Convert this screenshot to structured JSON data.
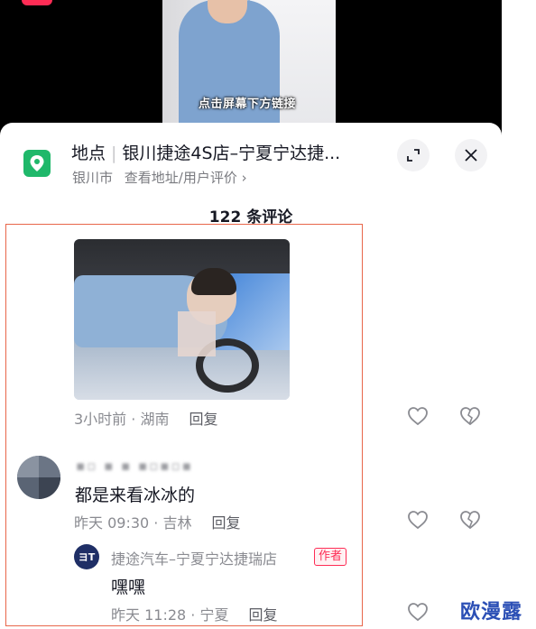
{
  "video": {
    "subtitle": "点击屏幕下方链接"
  },
  "location": {
    "label": "地点",
    "name": "银川捷途4S店–宁夏宁达捷...",
    "city": "银川市",
    "link": "查看地址/用户评价 ›"
  },
  "comments_header": "122 条评论",
  "comments": [
    {
      "meta": "3小时前 · 湖南",
      "reply": "回复"
    },
    {
      "user": "▪▫ ▪ ▪ ▪▫▪▫▪",
      "text": "都是来看冰冰的",
      "meta": "昨天 09:30 · 吉林",
      "reply": "回复"
    }
  ],
  "reply": {
    "avatar_text": "ヨT",
    "user": "捷途汽车–宁夏宁达捷瑞店",
    "tag": "作者",
    "text": "嘿嘿",
    "meta": "昨天 11:28 · 宁夏",
    "reply": "回复"
  },
  "watermark": "欧漫露",
  "colors": {
    "accent": "#fe2c55",
    "location_green": "#1fb86a",
    "highlight_border": "#e8664a"
  }
}
